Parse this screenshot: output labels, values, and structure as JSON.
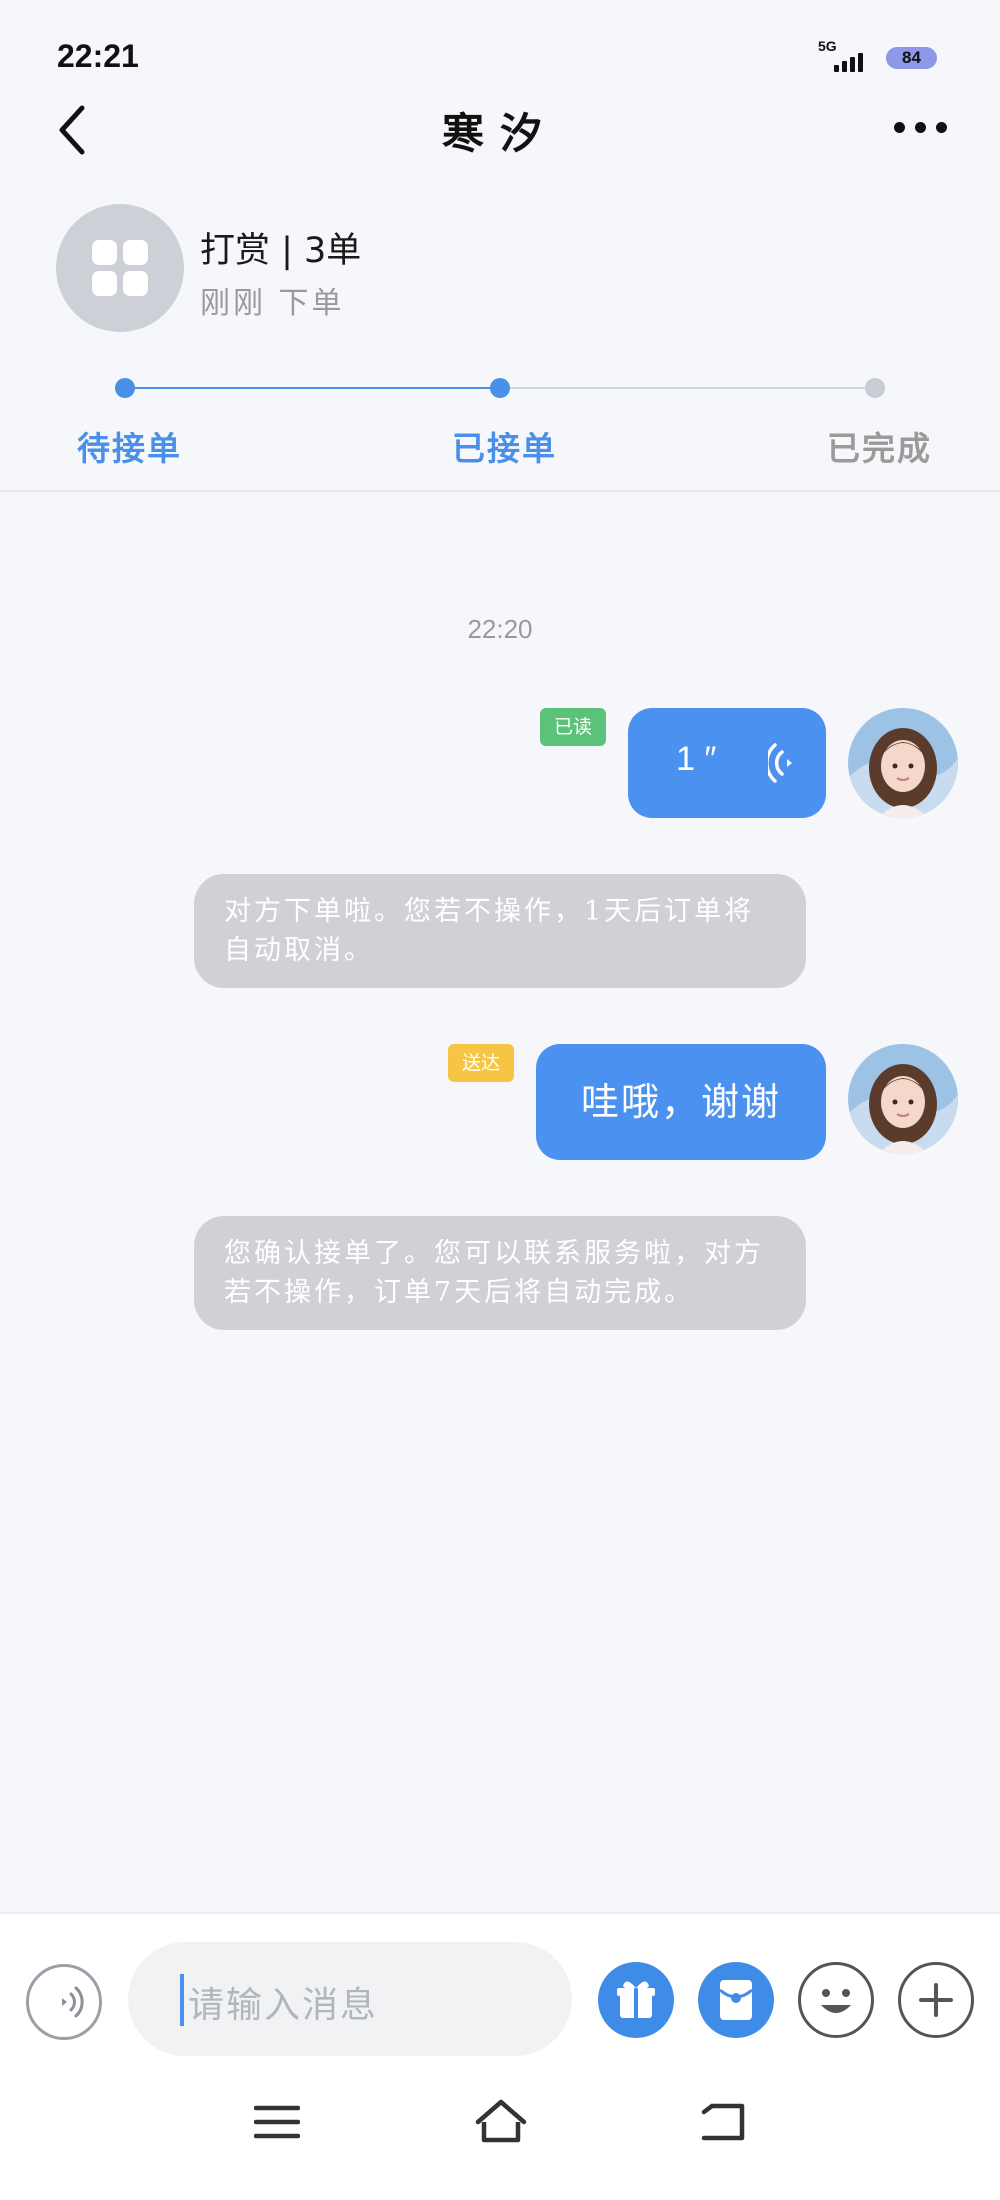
{
  "status_bar": {
    "time": "22:21",
    "network": "5G",
    "battery": "84"
  },
  "nav": {
    "title": "寒汐",
    "back_icon": "back-arrow-icon",
    "more_icon": "more-dots-icon"
  },
  "order": {
    "title": "打赏 | 3单",
    "subtitle": "刚刚 下单",
    "icon": "apps-grid-icon"
  },
  "progress": {
    "steps": [
      {
        "label": "待接单",
        "state": "done"
      },
      {
        "label": "已接单",
        "state": "current"
      },
      {
        "label": "已完成",
        "state": "todo"
      }
    ]
  },
  "chat": {
    "time": "22:20",
    "messages": [
      {
        "type": "voice",
        "duration": "1 ″",
        "status": "已读"
      },
      {
        "type": "system",
        "text": "对方下单啦。您若不操作，1天后订单将自动取消。"
      },
      {
        "type": "text",
        "text": "哇哦，谢谢",
        "status": "送达"
      },
      {
        "type": "system",
        "text": "您确认接单了。您可以联系服务啦，对方若不操作，订单7天后将自动完成。"
      }
    ]
  },
  "input_bar": {
    "placeholder": "请输入消息",
    "buttons": [
      "voice-icon",
      "gift-icon",
      "red-packet-icon",
      "emoji-icon",
      "plus-icon"
    ]
  },
  "colors": {
    "accent": "#4b91ef",
    "read_badge": "#5cc27a",
    "delivered_badge": "#f5c543",
    "system_bubble": "#cfd1d6",
    "inactive": "#9a9a9a"
  }
}
